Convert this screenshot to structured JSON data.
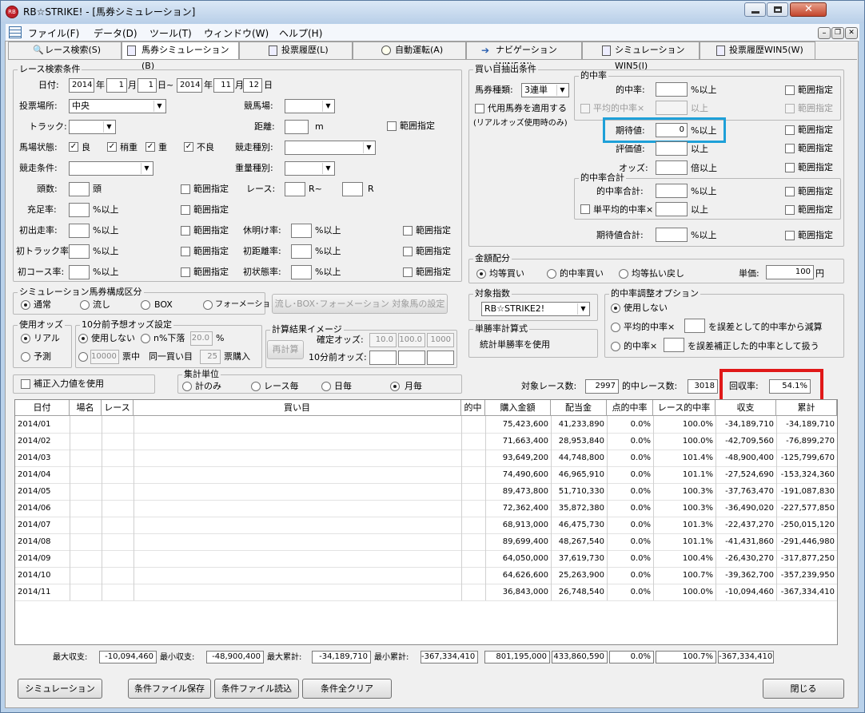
{
  "window": {
    "title": "RB☆STRIKE! - [馬券シミュレーション]"
  },
  "menu": [
    "ファイル(F)",
    "データ(D)",
    "ツール(T)",
    "ウィンドウ(W)",
    "ヘルプ(H)"
  ],
  "tabs": [
    "レース検索(S)",
    "馬券シミュレーション(B)",
    "投票履歴(L)",
    "自動運転(A)",
    "ナビゲーションWIN5(N)",
    "シミュレーションWIN5(I)",
    "投票履歴WIN5(W)"
  ],
  "race": {
    "group": "レース検索条件",
    "date_label": "日付:",
    "y1": "2014",
    "m1": "1",
    "d1": "1",
    "y2": "2014",
    "m2": "11",
    "d2": "12",
    "u_year": "年",
    "u_month": "月",
    "u_day_from": "日~",
    "u_day": "日",
    "venue_label": "投票場所:",
    "venue_value": "中央",
    "course_label": "競馬場:",
    "track_label": "トラック:",
    "distance_label": "距離:",
    "distance_unit": "m",
    "range": "範囲指定",
    "cond_label": "馬場状態:",
    "cond_ryo": "良",
    "cond_yaya": "稍重",
    "cond_omo": "重",
    "cond_furyo": "不良",
    "type_label": "競走種別:",
    "race_cond_label": "競走条件:",
    "weight_label": "重量種別:",
    "heads_label": "頭数:",
    "heads_unit": "頭",
    "race_label": "レース:",
    "r_from": "R~",
    "r_to": "R",
    "fill_label": "充足率:",
    "pct_over": "%以上",
    "first_label": "初出走率:",
    "rest_label": "休明け率:",
    "firsttrack_label": "初トラック率:",
    "firstdist_label": "初距離率:",
    "firstcourse_label": "初コース率:",
    "firstcond_label": "初状態率:"
  },
  "sim": {
    "group": "シミュレーション馬券構成区分",
    "normal": "通常",
    "nagashi": "流し",
    "box": "BOX",
    "formation": "フォーメーション",
    "setting_btn": "流し･BOX･フォーメーション 対象馬の設定",
    "odds_group": "使用オッズ",
    "real": "リアル",
    "forecast": "予測",
    "tenmin_group": "10分前予想オッズ設定",
    "not_use": "使用しない",
    "n_drop": "n%下落",
    "n_val": "20.0",
    "pct": "%",
    "ticket_val": "10000",
    "ticket_mid": "票中",
    "same": "同一買い目",
    "same_val": "25",
    "ticket_buy": "票購入",
    "image_group": "計算結果イメージ",
    "recalc": "再計算",
    "fixed_odds": "確定オッズ:",
    "o1": "10.0",
    "o2": "100.0",
    "o3": "1000",
    "tenmin_odds": "10分前オッズ:",
    "correction": "補正入力値を使用",
    "unit_group": "集計単位",
    "u_total": "計のみ",
    "u_race": "レース毎",
    "u_day": "日毎",
    "u_month": "月毎"
  },
  "buy": {
    "group": "買い目抽出条件",
    "type_label": "馬券種類:",
    "type_value": "3連単",
    "substitute": "代用馬券を適用する",
    "real_note": "(リアルオッズ使用時のみ)",
    "hit_group": "的中率",
    "hit_rate": "的中率:",
    "avg_hit": "平均的中率×",
    "pct_over": "%以上",
    "over": "以上",
    "expect": "期待値:",
    "expect_val": "0",
    "eval": "評価値:",
    "odds": "オッズ:",
    "times_over": "倍以上",
    "hit_sum_group": "的中率合計",
    "hit_sum": "的中率合計:",
    "single_avg": "単平均的中率×",
    "expect_sum": "期待値合計:",
    "range": "範囲指定"
  },
  "money": {
    "group": "金額配分",
    "equal_buy": "均等買い",
    "hit_buy": "的中率買い",
    "equal_pay": "均等払い戻し",
    "unit_label": "単価:",
    "unit_val": "100",
    "yen": "円"
  },
  "target": {
    "group": "対象指数",
    "value": "RB☆STRIKE2!",
    "win_group": "単勝率計算式",
    "win_text": "統計単勝率を使用"
  },
  "adjust": {
    "group": "的中率調整オプション",
    "not_use": "使用しない",
    "avg": "平均的中率×",
    "avg_tail": "を誤差として的中率から減算",
    "hit": "的中率×",
    "hit_tail": "を誤差補正した的中率として扱う"
  },
  "stats": {
    "races_label": "対象レース数:",
    "races": "2997",
    "hit_label": "的中レース数:",
    "hit": "3018",
    "recovery_label": "回収率:",
    "recovery": "54.1%"
  },
  "table": {
    "headers": [
      "日付",
      "場名",
      "レース",
      "買い目",
      "的中",
      "購入金額",
      "配当金",
      "点的中率",
      "レース的中率",
      "収支",
      "累計"
    ],
    "rows": [
      [
        "2014/01",
        "",
        "",
        "",
        "",
        "75,423,600",
        "41,233,890",
        "0.0%",
        "100.0%",
        "-34,189,710",
        "-34,189,710"
      ],
      [
        "2014/02",
        "",
        "",
        "",
        "",
        "71,663,400",
        "28,953,840",
        "0.0%",
        "100.0%",
        "-42,709,560",
        "-76,899,270"
      ],
      [
        "2014/03",
        "",
        "",
        "",
        "",
        "93,649,200",
        "44,748,800",
        "0.0%",
        "101.4%",
        "-48,900,400",
        "-125,799,670"
      ],
      [
        "2014/04",
        "",
        "",
        "",
        "",
        "74,490,600",
        "46,965,910",
        "0.0%",
        "101.1%",
        "-27,524,690",
        "-153,324,360"
      ],
      [
        "2014/05",
        "",
        "",
        "",
        "",
        "89,473,800",
        "51,710,330",
        "0.0%",
        "100.3%",
        "-37,763,470",
        "-191,087,830"
      ],
      [
        "2014/06",
        "",
        "",
        "",
        "",
        "72,362,400",
        "35,872,380",
        "0.0%",
        "100.3%",
        "-36,490,020",
        "-227,577,850"
      ],
      [
        "2014/07",
        "",
        "",
        "",
        "",
        "68,913,000",
        "46,475,730",
        "0.0%",
        "101.3%",
        "-22,437,270",
        "-250,015,120"
      ],
      [
        "2014/08",
        "",
        "",
        "",
        "",
        "89,699,400",
        "48,267,540",
        "0.0%",
        "101.1%",
        "-41,431,860",
        "-291,446,980"
      ],
      [
        "2014/09",
        "",
        "",
        "",
        "",
        "64,050,000",
        "37,619,730",
        "0.0%",
        "100.4%",
        "-26,430,270",
        "-317,877,250"
      ],
      [
        "2014/10",
        "",
        "",
        "",
        "",
        "64,626,600",
        "25,263,900",
        "0.0%",
        "100.7%",
        "-39,362,700",
        "-357,239,950"
      ],
      [
        "2014/11",
        "",
        "",
        "",
        "",
        "36,843,000",
        "26,748,540",
        "0.0%",
        "100.0%",
        "-10,094,460",
        "-367,334,410"
      ]
    ]
  },
  "summary": {
    "max_label": "最大収支:",
    "max": "-10,094,460",
    "min_label": "最小収支:",
    "min": "-48,900,400",
    "maxcum_label": "最大累計:",
    "maxcum": "-34,189,710",
    "mincum_label": "最小累計:",
    "mincum": "-367,334,410",
    "buy": "801,195,000",
    "pay": "433,860,590",
    "point": "0.0%",
    "race": "100.7%",
    "total": "-367,334,410"
  },
  "buttons": {
    "simulate": "シミュレーション",
    "save": "条件ファイル保存",
    "load": "条件ファイル読込",
    "clear": "条件全クリア",
    "close": "閉じる"
  },
  "highlights": {
    "expect_box": "#1ea0d8",
    "recovery_box": "#e01818"
  }
}
